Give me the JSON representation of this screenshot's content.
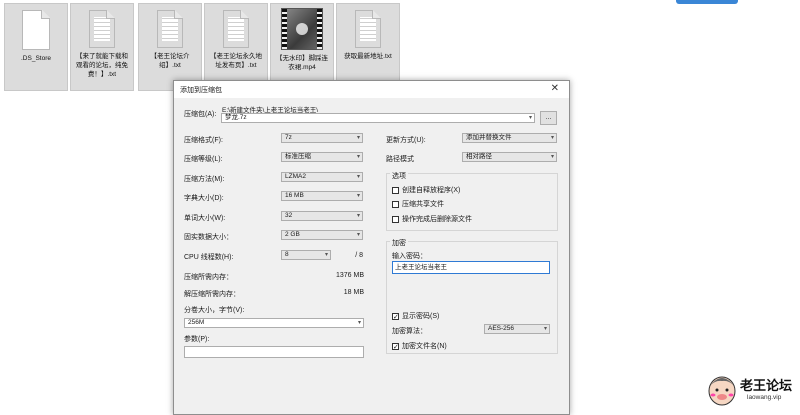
{
  "files": [
    {
      "name": ".DS_Store",
      "kind": "doc"
    },
    {
      "name": "【来了就能下载和观看的论坛，纯免费！】.txt",
      "kind": "doc-lines"
    },
    {
      "name": "【老王论坛介绍】.txt",
      "kind": "doc-lines"
    },
    {
      "name": "【老王论坛永久地址发布页】.txt",
      "kind": "doc-lines"
    },
    {
      "name": "【无水印】脚踩连衣裙.mp4",
      "kind": "video"
    },
    {
      "name": "获取最新地址.txt",
      "kind": "doc-lines"
    }
  ],
  "dialog": {
    "title": "添加到压缩包",
    "close": "✕",
    "archive_label": "压缩包(A):",
    "archive_path": "E:\\新建文件夹\\上老王论坛当老王\\",
    "archive_name": "梦龙.7z",
    "browse": "...",
    "format_label": "压缩格式(F):",
    "format": "7z",
    "level_label": "压缩等级(L):",
    "level": "标准压缩",
    "method_label": "压缩方法(M):",
    "method": "LZMA2",
    "dict_label": "字典大小(D):",
    "dict": "16 MB",
    "word_label": "单词大小(W):",
    "word": "32",
    "solid_label": "固实数据大小：",
    "solid": "2 GB",
    "threads_label": "CPU 线程数(H):",
    "threads": "8",
    "threads_total": "/ 8",
    "mem_compress_label": "压缩所需内存：",
    "mem_compress": "1376 MB",
    "mem_decompress_label": "解压缩所需内存：",
    "mem_decompress": "18 MB",
    "split_label": "分卷大小，字节(V):",
    "split": "256M",
    "params_label": "参数(P):",
    "params": "",
    "update_label": "更新方式(U):",
    "update": "添加并替换文件",
    "path_label": "路径模式",
    "path": "相对路径",
    "options_title": "选项",
    "opt_sfx": "创建自释放程序(X)",
    "opt_shared": "压缩共享文件",
    "opt_delete": "操作完成后删除源文件",
    "encrypt_title": "加密",
    "password_label": "输入密码：",
    "password": "上老王论坛当老王",
    "show_password": "显示密码(S)",
    "encrypt_method_label": "加密算法：",
    "encrypt_method": "AES-256",
    "encrypt_names": "加密文件名(N)",
    "check": "✓"
  },
  "watermark": {
    "title": "老王论坛",
    "url": "laowang.vip"
  }
}
